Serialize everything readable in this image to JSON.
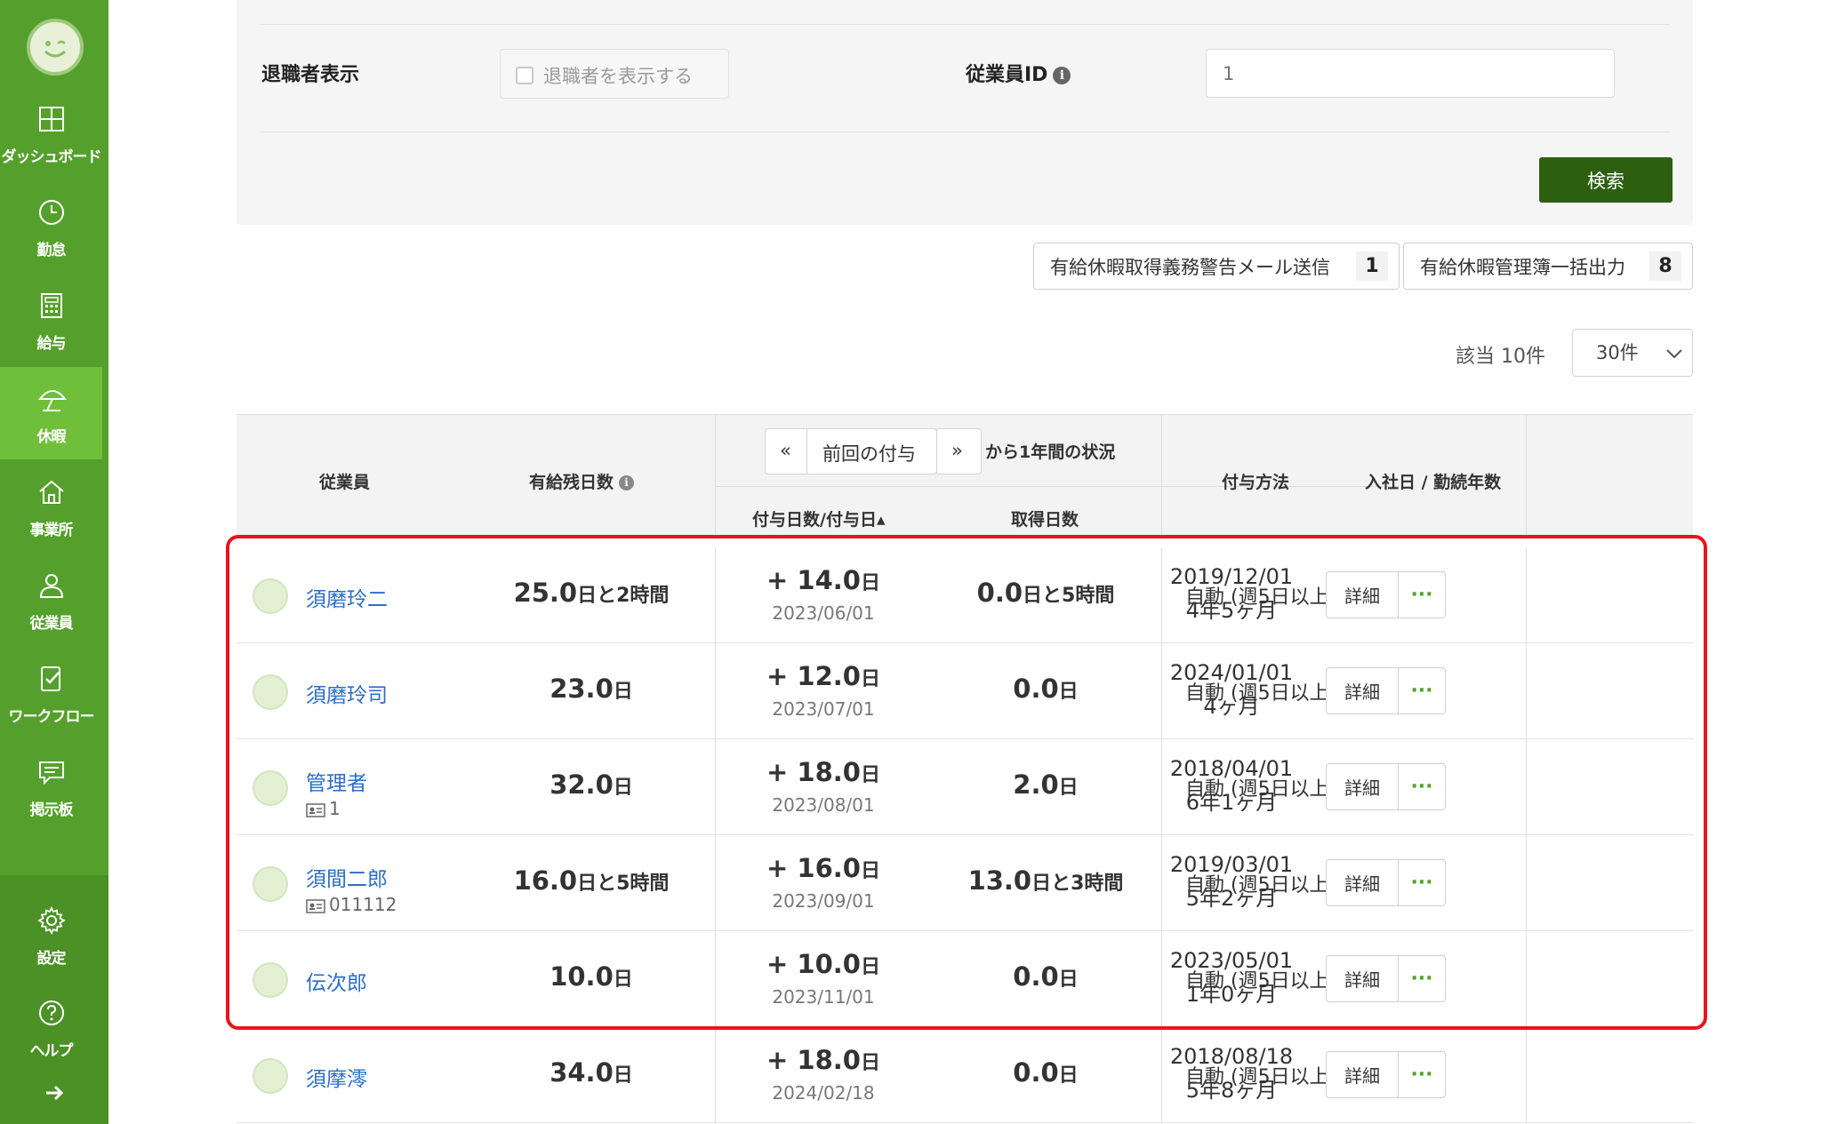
{
  "sidebar": {
    "items": [
      {
        "label": "ダッシュボード",
        "icon": "dashboard-icon"
      },
      {
        "label": "勤怠",
        "icon": "clock-icon"
      },
      {
        "label": "給与",
        "icon": "calculator-icon"
      },
      {
        "label": "休暇",
        "icon": "umbrella-icon"
      },
      {
        "label": "事業所",
        "icon": "home-icon"
      },
      {
        "label": "従業員",
        "icon": "person-icon"
      },
      {
        "label": "ワークフロー",
        "icon": "workflow-icon"
      },
      {
        "label": "掲示板",
        "icon": "chat-icon"
      },
      {
        "label": "設定",
        "icon": "gear-icon"
      },
      {
        "label": "ヘルプ",
        "icon": "help-icon"
      }
    ],
    "active": "休暇"
  },
  "filter": {
    "retired_label": "退職者表示",
    "retired_checkbox_label": "退職者を表示する",
    "employee_id_label": "従業員ID",
    "employee_id_placeholder": "1",
    "search_button": "検索"
  },
  "actions": {
    "warning_mail_label": "有給休暇取得義務警告メール送信",
    "warning_mail_count": "1",
    "ledger_export_label": "有給休暇管理簿一括出力",
    "ledger_export_count": "8"
  },
  "results": {
    "hits": "該当 10件",
    "per_page": "30件"
  },
  "table": {
    "headers": {
      "employee": "従業員",
      "remaining": "有給残日数",
      "prev_arrow": "«",
      "grant_nav": "前回の付与",
      "next_arrow": "»",
      "period_suffix": "から1年間の状況",
      "granted": "付与日数/付与日▴",
      "taken": "取得日数",
      "method": "付与方法",
      "join": "入社日 / 勤続年数"
    },
    "rows": [
      {
        "name": "須磨玲二",
        "emp_id": "",
        "remaining_num": "25.0",
        "remaining_unit": "日と2時間",
        "granted_num": "+ 14.0",
        "granted_unit": "日",
        "granted_date": "2023/06/01",
        "taken_num": "0.0",
        "taken_unit": "日と5時間",
        "method": "自動 (週5日以上)",
        "join_date": "2019/12/01",
        "tenure": "4年5ヶ月"
      },
      {
        "name": "須磨玲司",
        "emp_id": "",
        "remaining_num": "23.0",
        "remaining_unit": "日",
        "granted_num": "+ 12.0",
        "granted_unit": "日",
        "granted_date": "2023/07/01",
        "taken_num": "0.0",
        "taken_unit": "日",
        "method": "自動 (週5日以上)",
        "join_date": "2024/01/01",
        "tenure": "4ヶ月"
      },
      {
        "name": "管理者",
        "emp_id": "1",
        "remaining_num": "32.0",
        "remaining_unit": "日",
        "granted_num": "+ 18.0",
        "granted_unit": "日",
        "granted_date": "2023/08/01",
        "taken_num": "2.0",
        "taken_unit": "日",
        "method": "自動 (週5日以上)",
        "join_date": "2018/04/01",
        "tenure": "6年1ヶ月"
      },
      {
        "name": "須間二郎",
        "emp_id": "011112",
        "remaining_num": "16.0",
        "remaining_unit": "日と5時間",
        "granted_num": "+ 16.0",
        "granted_unit": "日",
        "granted_date": "2023/09/01",
        "taken_num": "13.0",
        "taken_unit": "日と3時間",
        "method": "自動 (週5日以上)",
        "join_date": "2019/03/01",
        "tenure": "5年2ヶ月"
      },
      {
        "name": "伝次郎",
        "emp_id": "",
        "remaining_num": "10.0",
        "remaining_unit": "日",
        "granted_num": "+ 10.0",
        "granted_unit": "日",
        "granted_date": "2023/11/01",
        "taken_num": "0.0",
        "taken_unit": "日",
        "method": "自動 (週5日以上)",
        "join_date": "2023/05/01",
        "tenure": "1年0ヶ月"
      },
      {
        "name": "須摩澪",
        "emp_id": "",
        "remaining_num": "34.0",
        "remaining_unit": "日",
        "granted_num": "+ 18.0",
        "granted_unit": "日",
        "granted_date": "2024/02/18",
        "taken_num": "0.0",
        "taken_unit": "日",
        "method": "自動 (週5日以上)",
        "join_date": "2018/08/18",
        "tenure": "5年8ヶ月"
      }
    ],
    "detail_button": "詳細",
    "more_button": "···"
  },
  "colors": {
    "sidebar": "#55a02c",
    "sidebar_active": "#6fbf3a",
    "primary_button": "#2d5f10",
    "link": "#2b6ec6",
    "highlight": "#e8141e"
  }
}
